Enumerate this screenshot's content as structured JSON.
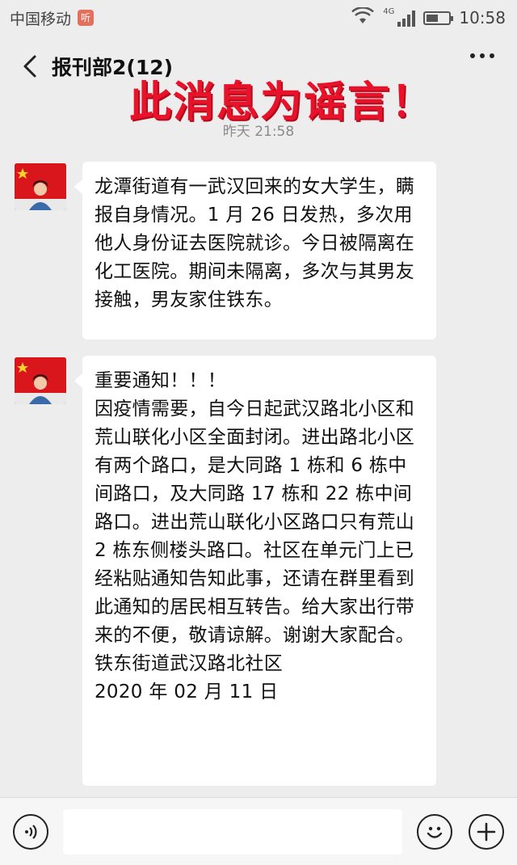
{
  "status_bar": {
    "carrier": "中国移动",
    "carrier_badge": "听",
    "network": "4G",
    "time": "10:58",
    "battery_level": 0.55
  },
  "header": {
    "back_icon": "chevron-left-icon",
    "title": "报刊部2(12)",
    "more_icon": "more-dots-icon"
  },
  "overlay": {
    "rumor_text": "此消息为谣言！"
  },
  "chat": {
    "timestamp": "昨天 21:58",
    "messages": [
      {
        "sender_avatar": "flag-avatar",
        "text": "龙潭街道有一武汉回来的女大学生，瞒报自身情况。1 月 26 日发热，多次用他人身份证去医院就诊。今日被隔离在化工医院。期间未隔离，多次与其男友接触，男友家住铁东。"
      },
      {
        "sender_avatar": "flag-avatar",
        "text": "重要通知！！！\n因疫情需要，自今日起武汉路北小区和荒山联化小区全面封闭。进出路北小区有两个路口，是大同路 1 栋和 6 栋中间路口，及大同路 17 栋和 22 栋中间路口。进出荒山联化小区路口只有荒山 2 栋东侧楼头路口。社区在单元门上已经粘贴通知告知此事，还请在群里看到此通知的居民相互转告。给大家出行带来的不便，敬请谅解。谢谢大家配合。\n铁东街道武汉路北社区\n2020 年 02 月 11 日"
      }
    ]
  },
  "input_bar": {
    "voice_icon": "voice-icon",
    "input_value": "",
    "emoji_icon": "emoji-icon",
    "plus_icon": "plus-icon"
  },
  "colors": {
    "background": "#ededed",
    "bubble": "#ffffff",
    "rumor_red": "#e8132a"
  }
}
